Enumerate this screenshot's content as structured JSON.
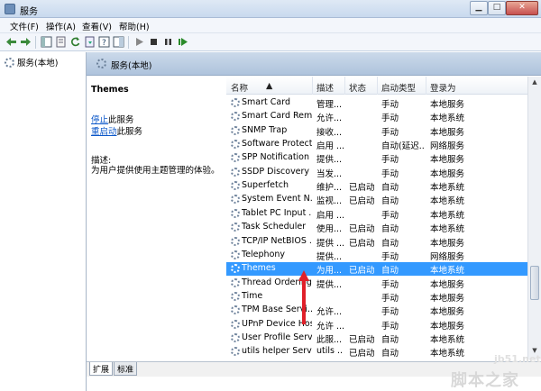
{
  "window": {
    "title": "服务"
  },
  "menu": [
    "文件(F)",
    "操作(A)",
    "查看(V)",
    "帮助(H)"
  ],
  "tree": {
    "root": "服务(本地)"
  },
  "header": {
    "title": "服务(本地)"
  },
  "details": {
    "service_name": "Themes",
    "stop_link": "停止",
    "stop_suffix": "此服务",
    "restart_link": "重启动",
    "restart_suffix": "此服务",
    "desc_label": "描述:",
    "desc_text": "为用户提供使用主题管理的体验。"
  },
  "columns": [
    "名称",
    "描述",
    "状态",
    "启动类型",
    "登录为"
  ],
  "rows": [
    {
      "name": "Smart Card",
      "desc": "管理...",
      "status": "",
      "startup": "手动",
      "logon": "本地服务"
    },
    {
      "name": "Smart Card Rem...",
      "desc": "允许...",
      "status": "",
      "startup": "手动",
      "logon": "本地系统"
    },
    {
      "name": "SNMP Trap",
      "desc": "接收...",
      "status": "",
      "startup": "手动",
      "logon": "本地服务"
    },
    {
      "name": "Software Protect...",
      "desc": "启用 ...",
      "status": "",
      "startup": "自动(延迟...",
      "logon": "网络服务"
    },
    {
      "name": "SPP Notification ...",
      "desc": "提供...",
      "status": "",
      "startup": "手动",
      "logon": "本地服务"
    },
    {
      "name": "SSDP Discovery",
      "desc": "当发...",
      "status": "",
      "startup": "手动",
      "logon": "本地服务"
    },
    {
      "name": "Superfetch",
      "desc": "维护...",
      "status": "已启动",
      "startup": "自动",
      "logon": "本地系统"
    },
    {
      "name": "System Event N...",
      "desc": "监视...",
      "status": "已启动",
      "startup": "自动",
      "logon": "本地系统"
    },
    {
      "name": "Tablet PC Input ...",
      "desc": "启用 ...",
      "status": "",
      "startup": "手动",
      "logon": "本地系统"
    },
    {
      "name": "Task Scheduler",
      "desc": "使用...",
      "status": "已启动",
      "startup": "自动",
      "logon": "本地系统"
    },
    {
      "name": "TCP/IP NetBIOS ...",
      "desc": "提供 ...",
      "status": "已启动",
      "startup": "自动",
      "logon": "本地服务"
    },
    {
      "name": "Telephony",
      "desc": "提供...",
      "status": "",
      "startup": "手动",
      "logon": "网络服务"
    },
    {
      "name": "Themes",
      "desc": "为用...",
      "status": "已启动",
      "startup": "自动",
      "logon": "本地系统",
      "selected": true
    },
    {
      "name": "Thread Ordering...",
      "desc": "提供...",
      "status": "",
      "startup": "手动",
      "logon": "本地服务"
    },
    {
      "name": "Time",
      "desc": "",
      "status": "",
      "startup": "手动",
      "logon": "本地服务"
    },
    {
      "name": "TPM Base Servi...",
      "desc": "允许...",
      "status": "",
      "startup": "手动",
      "logon": "本地服务"
    },
    {
      "name": "UPnP Device Host",
      "desc": "允许 ...",
      "status": "",
      "startup": "手动",
      "logon": "本地服务"
    },
    {
      "name": "User Profile Serv...",
      "desc": "此服...",
      "status": "已启动",
      "startup": "自动",
      "logon": "本地系统"
    },
    {
      "name": "utils helper Servi...",
      "desc": "utils ...",
      "status": "已启动",
      "startup": "自动",
      "logon": "本地系统"
    }
  ],
  "tabs": [
    "扩展",
    "标准"
  ],
  "watermark": {
    "domain": "jb51.net",
    "name": "脚本之家"
  },
  "colors": {
    "selection": "#3399ff",
    "link": "#0b57c9",
    "arrow": "#e0202a"
  }
}
